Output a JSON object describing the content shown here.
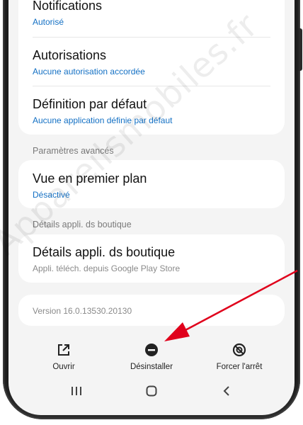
{
  "settings": {
    "notifications": {
      "title": "Notifications",
      "value": "Autorisé"
    },
    "permissions": {
      "title": "Autorisations",
      "value": "Aucune autorisation accordée"
    },
    "default": {
      "title": "Définition par défaut",
      "value": "Aucune application définie par défaut"
    }
  },
  "advanced": {
    "section_label": "Paramètres avancés",
    "foreground": {
      "title": "Vue en premier plan",
      "value": "Désactivé"
    }
  },
  "store": {
    "section_label": "Détails appli. ds boutique",
    "details": {
      "title": "Détails appli. ds boutique",
      "value": "Appli. téléch. depuis Google Play Store"
    }
  },
  "version": "Version 16.0.13530.20130",
  "actions": [
    {
      "label": "Ouvrir",
      "icon": "open-external-icon"
    },
    {
      "label": "Désinstaller",
      "icon": "uninstall-icon"
    },
    {
      "label": "Forcer l'arrêt",
      "icon": "force-stop-icon"
    }
  ],
  "nav": {
    "recents": "recents-icon",
    "home": "home-icon",
    "back": "back-icon"
  },
  "watermark": "Appareilsmobiles.fr",
  "colors": {
    "accent": "#1370c4",
    "arrow": "#e0001b",
    "background": "#f4f4f4"
  }
}
